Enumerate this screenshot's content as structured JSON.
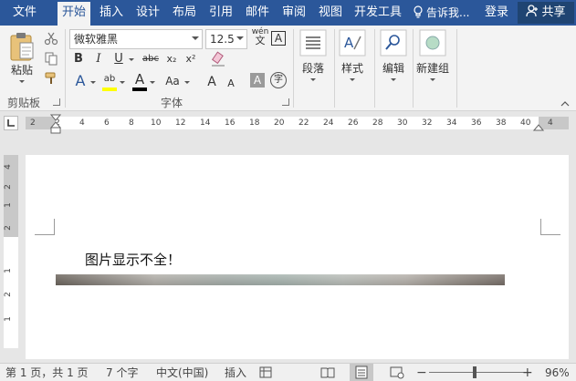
{
  "tabs": [
    {
      "label": "文件",
      "active": false
    },
    {
      "label": "开始",
      "active": true
    },
    {
      "label": "插入",
      "active": false
    },
    {
      "label": "设计",
      "active": false
    },
    {
      "label": "布局",
      "active": false
    },
    {
      "label": "引用",
      "active": false
    },
    {
      "label": "邮件",
      "active": false
    },
    {
      "label": "审阅",
      "active": false
    },
    {
      "label": "视图",
      "active": false
    },
    {
      "label": "开发工具",
      "active": false
    }
  ],
  "tell_me": "告诉我...",
  "login_label": "登录",
  "share_label": "共享",
  "clipboard": {
    "paste_label": "粘贴",
    "group_label": "剪贴板"
  },
  "font": {
    "name": "微软雅黑",
    "size": "12.5",
    "phonetic": "wén",
    "group_label": "字体",
    "bold": "B",
    "italic": "I",
    "underline": "U",
    "strikethrough": "abc",
    "subscript": "x₂",
    "superscript": "x²",
    "change_case": "Aa",
    "grow": "A",
    "shrink": "A",
    "char_shading": "A",
    "enclose": "字",
    "border": "A",
    "effects": "A",
    "highlight": "ab",
    "font_color": "A"
  },
  "groups": {
    "paragraph": "段落",
    "styles": "样式",
    "editing": "编辑",
    "new_group": "新建组"
  },
  "ruler": {
    "numbers": [
      "2",
      "2",
      "4",
      "6",
      "8",
      "10",
      "12",
      "14",
      "16",
      "18",
      "20",
      "22",
      "24",
      "26",
      "28",
      "30",
      "32",
      "34",
      "36",
      "38",
      "40",
      "4"
    ],
    "vertical_numbers": [
      "4",
      "2",
      "1",
      "2",
      "1",
      "2",
      "1"
    ]
  },
  "document": {
    "text": "图片显示不全！"
  },
  "status": {
    "page": "第 1 页，共 1 页",
    "words": "7 个字",
    "language": "中文(中国)",
    "mode": "插入",
    "zoom": "96%",
    "zoom_level": 0.48
  },
  "colors": {
    "accent": "#2b579a",
    "font_color_bar": "#000000",
    "highlight_bar": "#ffff00"
  }
}
